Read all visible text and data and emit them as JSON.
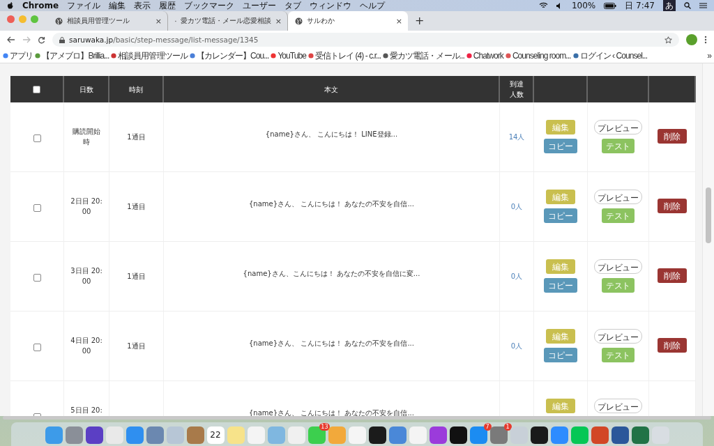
{
  "menubar": {
    "app": "Chrome",
    "menus": [
      "ファイル",
      "編集",
      "表示",
      "履歴",
      "ブックマーク",
      "ユーザー",
      "タブ",
      "ウィンドウ",
      "ヘルプ"
    ],
    "battery": "100%",
    "clock": "日 7:47",
    "input_method": "あ"
  },
  "tabs": [
    {
      "title": "相談員用管理ツール",
      "close": "×",
      "selected": false
    },
    {
      "title": "愛カツ電話・メール恋愛相談",
      "close": "×",
      "selected": false
    },
    {
      "title": "サルわか",
      "close": "×",
      "selected": true
    }
  ],
  "new_tab": "+",
  "address": {
    "host": "saruwaka.jp",
    "path": "/basic/step-message/list-message/1345"
  },
  "bookmarks": [
    "アプリ",
    "【アメブロ】Brillia...",
    "相談員用管理ツール",
    "【カレンダー】Cou...",
    "YouTube",
    "受信トレイ (4) - c.r...",
    "愛カツ電話・メール...",
    "Chatwork",
    "Counseling room...",
    "ログイン ‹ Counsel..."
  ],
  "bookmarks_more": "»",
  "table": {
    "select_all_checked": false,
    "columns": [
      "日数",
      "時刻",
      "本文",
      "到達人数"
    ],
    "rows": [
      {
        "checked": false,
        "day": "購読開始時",
        "time": "1通目",
        "text": "{name}さん、 こんにちは！ LINE登録...",
        "count": "14人",
        "edit": "編集",
        "copy": "コピー",
        "preview": "プレビュー",
        "test": "テスト",
        "delete": "削除"
      },
      {
        "checked": false,
        "day": "2日目 20:00",
        "time": "1通目",
        "text": "{name}さん、 こんにちは！ あなたの不安を自信...",
        "count": "0人",
        "edit": "編集",
        "copy": "コピー",
        "preview": "プレビュー",
        "test": "テスト",
        "delete": "削除"
      },
      {
        "checked": false,
        "day": "3日目 20:00",
        "time": "1通目",
        "text": "{name}さん、こんにちは！ あなたの不安を自信に変...",
        "count": "0人",
        "edit": "編集",
        "copy": "コピー",
        "preview": "プレビュー",
        "test": "テスト",
        "delete": "削除"
      },
      {
        "checked": false,
        "day": "4日目 20:00",
        "time": "1通目",
        "text": "{name}さん、 こんにちは！ あなたの不安を自信...",
        "count": "0人",
        "edit": "編集",
        "copy": "コピー",
        "preview": "プレビュー",
        "test": "テスト",
        "delete": "削除"
      },
      {
        "checked": false,
        "day": "5日目 20:",
        "text": "{name}さん、 こんにちは！ あなたの不安を自信...",
        "edit": "編集",
        "preview": "プレビュー"
      }
    ]
  },
  "dock": [
    {
      "color": "#3d9be9"
    },
    {
      "color": "#8a8f98"
    },
    {
      "color": "#5b3fc4"
    },
    {
      "color": "#e9e9e9"
    },
    {
      "color": "#2f8ff0"
    },
    {
      "color": "#6b88b0"
    },
    {
      "color": "#b7c6d6"
    },
    {
      "color": "#a87a4a"
    },
    {
      "color": "#ffffff",
      "text": "22"
    },
    {
      "color": "#f7e38a"
    },
    {
      "color": "#f4f4f4"
    },
    {
      "color": "#7fb7e0"
    },
    {
      "color": "#f0f0f0"
    },
    {
      "color": "#3ccf4e",
      "badge": "13"
    },
    {
      "color": "#f2a93b"
    },
    {
      "color": "#f5f5f5"
    },
    {
      "color": "#1b1b1b"
    },
    {
      "color": "#4a88d8"
    },
    {
      "color": "#f4f4f4"
    },
    {
      "color": "#9b3bdb"
    },
    {
      "color": "#111111"
    },
    {
      "color": "#1b8cf2",
      "badge": "7"
    },
    {
      "color": "#7a7a7a",
      "badge": "1"
    },
    {
      "color": "#c8d0d8"
    },
    {
      "color": "#1a1a1a"
    },
    {
      "color": "#2d8cff"
    },
    {
      "color": "#06c755"
    },
    {
      "color": "#d24726"
    },
    {
      "color": "#2b579a"
    },
    {
      "color": "#217346"
    },
    {
      "color": "#d8dde2"
    }
  ]
}
